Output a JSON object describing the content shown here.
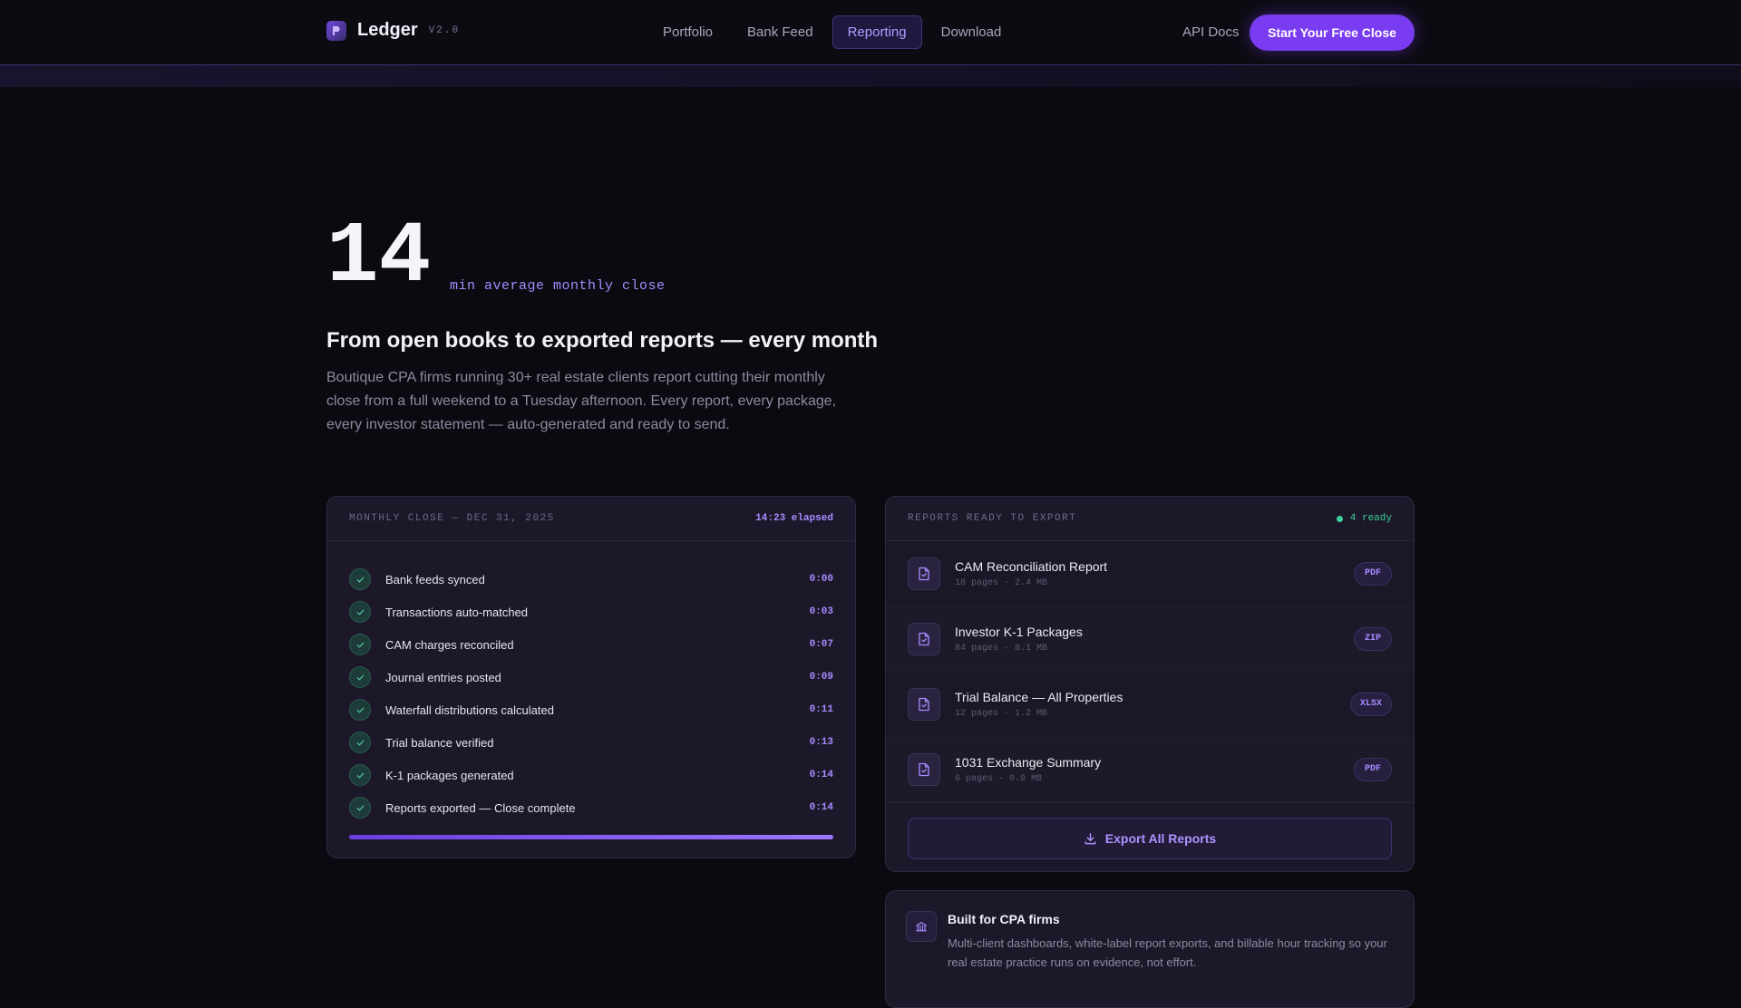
{
  "nav": {
    "brand": "Ledger",
    "version": "V2.0",
    "links": [
      {
        "label": "Portfolio",
        "active": false
      },
      {
        "label": "Bank Feed",
        "active": false
      },
      {
        "label": "Reporting",
        "active": true
      },
      {
        "label": "Download",
        "active": false
      }
    ],
    "api_docs": "API Docs",
    "cta": "Start Your Free Close"
  },
  "hero": {
    "number": "14",
    "unit": "min average monthly close",
    "title": "From open books to exported reports — every month",
    "body": "Boutique CPA firms running 30+ real estate clients report cutting their monthly close from a full weekend to a Tuesday afternoon. Every report, every package, every investor statement — auto-generated and ready to send."
  },
  "close_card": {
    "title": "MONTHLY CLOSE — DEC 31, 2025",
    "elapsed": "14:23 elapsed",
    "steps": [
      {
        "label": "Bank feeds synced",
        "time": "0:00"
      },
      {
        "label": "Transactions auto-matched",
        "time": "0:03"
      },
      {
        "label": "CAM charges reconciled",
        "time": "0:07"
      },
      {
        "label": "Journal entries posted",
        "time": "0:09"
      },
      {
        "label": "Waterfall distributions calculated",
        "time": "0:11"
      },
      {
        "label": "Trial balance verified",
        "time": "0:13"
      },
      {
        "label": "K-1 packages generated",
        "time": "0:14"
      },
      {
        "label": "Reports exported — Close complete",
        "time": "0:14"
      }
    ],
    "progress": 1.0
  },
  "reports_card": {
    "title": "REPORTS READY TO EXPORT",
    "ready": "4 ready",
    "reports": [
      {
        "name": "CAM Reconciliation Report",
        "meta": "18 pages · 2.4 MB",
        "format": "PDF"
      },
      {
        "name": "Investor K-1 Packages",
        "meta": "84 pages · 8.1 MB",
        "format": "ZIP"
      },
      {
        "name": "Trial Balance — All Properties",
        "meta": "12 pages · 1.2 MB",
        "format": "XLSX"
      },
      {
        "name": "1031 Exchange Summary",
        "meta": "6 pages · 0.9 MB",
        "format": "PDF"
      }
    ],
    "export_label": "Export All Reports"
  },
  "cpa_card": {
    "title": "Built for CPA firms",
    "body": "Multi-client dashboards, white-label report exports, and billable hour tracking so your real estate practice runs on evidence, not effort."
  },
  "colors": {
    "accent": "#7a3cf0",
    "accent_text": "#a58cff",
    "success": "#3ed29a",
    "background": "#0b0a10"
  }
}
